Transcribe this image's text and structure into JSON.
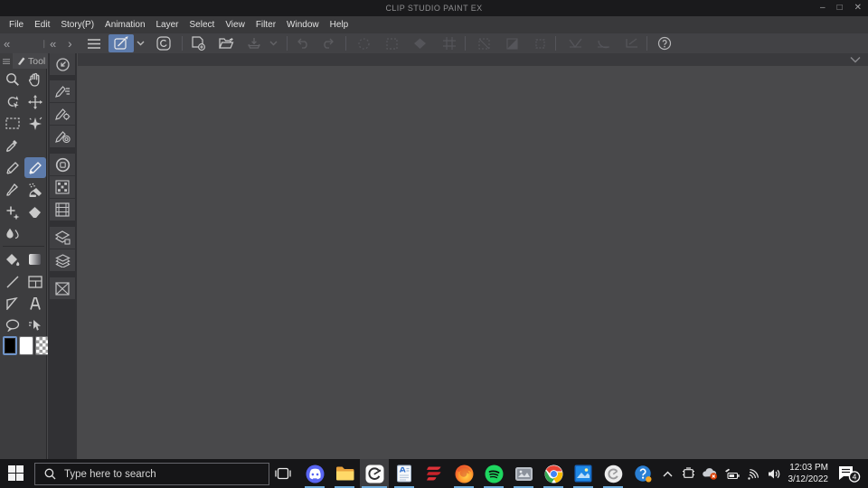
{
  "window": {
    "title": "CLIP STUDIO PAINT EX",
    "controls": [
      "minimize",
      "maximize",
      "close"
    ]
  },
  "menubar": {
    "items": [
      "File",
      "Edit",
      "Story(P)",
      "Animation",
      "Layer",
      "Select",
      "View",
      "Filter",
      "Window",
      "Help"
    ]
  },
  "toolbar": {
    "accent_color": "#5d7bab",
    "items": [
      "main-menu",
      "tablet-mode (selected)",
      "tablet-mode-dropdown",
      "clip-studio-home",
      "new-document",
      "open-file",
      "save-dropdown",
      "undo",
      "redo",
      "deselect",
      "reselect",
      "clear-selection",
      "crop",
      "invert-selection",
      "expand-selection",
      "shrink-selection",
      "snap-to-ruler",
      "snap-to-special-ruler",
      "snap-to-grid",
      "help"
    ]
  },
  "tool_palette": {
    "tab_label": "Tool",
    "tools": [
      "zoom",
      "hand",
      "rotate-canvas",
      "move-layer",
      "marquee-select",
      "auto-select",
      "eyedropper",
      "pen",
      "pen-selected",
      "brush",
      "airbrush",
      "decoration",
      "eraser",
      "blend",
      "fill",
      "gradient",
      "figure",
      "frame-border",
      "correct-line",
      "text",
      "balloon",
      "operation"
    ],
    "selected_tool": "pen-selected",
    "colors": {
      "main": "#000000",
      "sub": "#ffffff",
      "transparent": "checker",
      "selected": "main"
    }
  },
  "palette_strip": {
    "items": [
      "quick-access",
      "sub-tool",
      "tool-property",
      "sub-tool-detail",
      "color-wheel",
      "color-set",
      "material",
      "layer-property",
      "layer",
      "canvas-preview"
    ]
  },
  "taskbar": {
    "search_placeholder": "Type here to search",
    "apps": [
      "task-view",
      "discord",
      "file-explorer",
      "clip-studio-paint (active)",
      "document-app",
      "red-app",
      "firefox",
      "spotify",
      "gray-app",
      "chrome",
      "photos",
      "clip-studio-launcher",
      "help-app"
    ],
    "tray": [
      "hidden-icons",
      "tablet-settings",
      "onedrive-error",
      "battery-pen",
      "wifi",
      "volume"
    ],
    "clock": {
      "time": "12:03 PM",
      "date": "3/12/2022"
    },
    "notification_count": "4",
    "underline_color": "#71aede"
  }
}
